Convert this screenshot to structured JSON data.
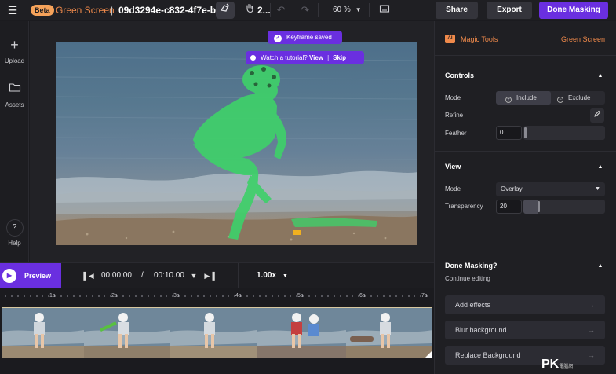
{
  "topbar": {
    "beta_badge": "Beta",
    "tool_name": "Green Screen",
    "separator": "|",
    "project_id": "09d3294e-c832-4f7e-b",
    "project_id_tail": "2...",
    "zoom_value": "60 %",
    "share_label": "Share",
    "export_label": "Export",
    "done_masking_label": "Done Masking",
    "icons": [
      "menu-icon",
      "brush-mask-icon",
      "hand-pan-icon",
      "undo-icon",
      "redo-icon",
      "zoom-caret-icon",
      "fit-screen-icon"
    ]
  },
  "left_rail": {
    "upload_label": "Upload",
    "assets_label": "Assets",
    "help_label": "Help"
  },
  "canvas": {
    "toast_saved": "Keyframe saved",
    "toast_tutorial": "Watch a tutorial?",
    "toast_view": "View",
    "toast_divider": "|",
    "toast_skip": "Skip"
  },
  "playback": {
    "preview_label": "Preview",
    "current_time": "00:00.00",
    "time_separator": "/",
    "total_time": "00:10.00",
    "speed": "1.00x"
  },
  "ruler": {
    "labels": [
      "1s",
      "2s",
      "3s",
      "4s",
      "5s",
      "6s",
      "7s"
    ]
  },
  "panel": {
    "ai_badge": "AI",
    "magic_tools_label": "Magic Tools",
    "green_screen_label": "Green Screen",
    "controls": {
      "title": "Controls",
      "mode_label": "Mode",
      "include_label": "Include",
      "exclude_label": "Exclude",
      "mode_selected": "Include",
      "refine_label": "Refine",
      "feather_label": "Feather",
      "feather_value": "0"
    },
    "view": {
      "title": "View",
      "mode_label": "Mode",
      "mode_value": "Overlay",
      "transparency_label": "Transparency",
      "transparency_value": "20"
    },
    "done": {
      "title": "Done Masking?",
      "continue_label": "Continue editing",
      "add_effects": "Add effects",
      "blur_background": "Blur background",
      "replace_background": "Replace Background"
    }
  },
  "watermark": {
    "text": "PK",
    "small": "電腦網"
  },
  "colors": {
    "accent_purple": "#6a2fe0",
    "accent_orange": "#f08a4b",
    "mask_green": "#3fd06a",
    "panel_bg": "#1f1f23"
  }
}
